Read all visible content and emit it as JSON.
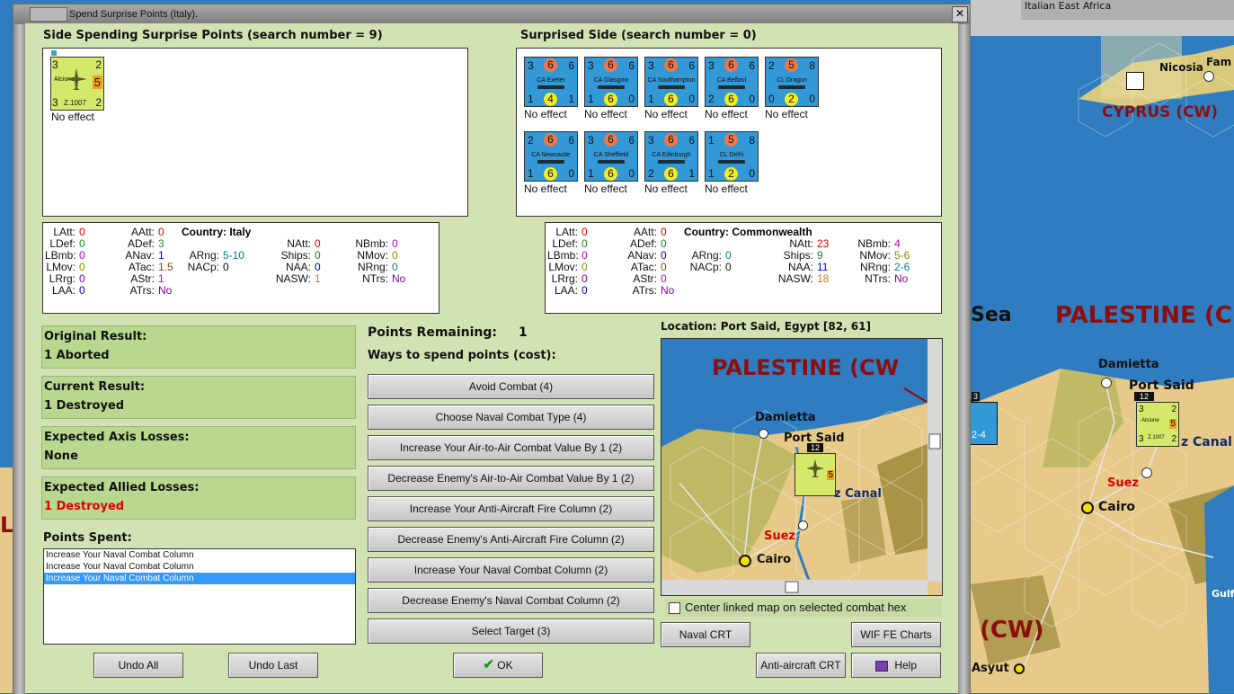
{
  "background_map": {
    "labels": {
      "italian_east_africa": "Italian East Africa",
      "nicosia": "Nicosia",
      "fam": "Fam",
      "cyprus": "CYPRUS (CW)",
      "sea": "Sea",
      "palestine": "PALESTINE (C",
      "damietta": "Damietta",
      "port_said": "Port Said",
      "canal": "z Canal",
      "suez": "Suez",
      "cairo": "Cairo",
      "cw": "(CW)",
      "asyut": "Asyut",
      "gulf": "Gulf",
      "l": "L",
      "t": "T"
    },
    "unit_stack": {
      "count": "12",
      "left": "3",
      "right": "2",
      "bottom_left": "3",
      "bottom_right": "2",
      "name": "Alcione",
      "type": "Z.1007",
      "value": "5"
    },
    "partial_unit": {
      "top": "3",
      "bottom": "2-4"
    }
  },
  "dialog": {
    "title": "Spend Surprise Points (Italy).",
    "close_label": "✕"
  },
  "side_spending": {
    "header": "Side Spending Surprise Points (search number = 9)",
    "units": [
      {
        "name": "Alcione",
        "type": "Z.1007",
        "tl": "3",
        "tr": "2",
        "bl": "3",
        "br": "2",
        "val": "5",
        "effect": "No effect"
      }
    ]
  },
  "surprised_side": {
    "header": "Surprised Side (search number = 0)",
    "units": [
      {
        "name": "CA Exeter",
        "tl": "3",
        "tc": "6",
        "tr": "6",
        "bl": "1",
        "bc": "4",
        "br": "1",
        "effect": "No effect"
      },
      {
        "name": "CA Glasgow",
        "tl": "3",
        "tc": "6",
        "tr": "6",
        "bl": "1",
        "bc": "6",
        "br": "0",
        "effect": "No effect"
      },
      {
        "name": "CA Southampton",
        "tl": "3",
        "tc": "6",
        "tr": "6",
        "bl": "1",
        "bc": "6",
        "br": "0",
        "effect": "No effect"
      },
      {
        "name": "CA Belfast",
        "tl": "3",
        "tc": "6",
        "tr": "6",
        "bl": "2",
        "bc": "6",
        "br": "0",
        "effect": "No effect"
      },
      {
        "name": "CL Dragon",
        "tl": "2",
        "tc": "5",
        "tr": "8",
        "bl": "0",
        "bc": "2",
        "br": "0",
        "effect": "No effect"
      },
      {
        "name": "CA Newcastle",
        "tl": "2",
        "tc": "6",
        "tr": "6",
        "bl": "1",
        "bc": "6",
        "br": "0",
        "effect": "No effect"
      },
      {
        "name": "CA Sheffield",
        "tl": "3",
        "tc": "6",
        "tr": "6",
        "bl": "1",
        "bc": "6",
        "br": "0",
        "effect": "No effect"
      },
      {
        "name": "CA Edinburgh",
        "tl": "3",
        "tc": "6",
        "tr": "6",
        "bl": "2",
        "bc": "6",
        "br": "1",
        "effect": "No effect"
      },
      {
        "name": "CL Delhi",
        "tl": "1",
        "tc": "5",
        "tr": "8",
        "bl": "1",
        "bc": "2",
        "br": "0",
        "effect": "No effect"
      }
    ]
  },
  "stats_italy": {
    "country_label": "Country: Italy",
    "latt": {
      "label": "LAtt:",
      "value": "0"
    },
    "ldef": {
      "label": "LDef:",
      "value": "0"
    },
    "lbmb": {
      "label": "LBmb:",
      "value": "0"
    },
    "lmov": {
      "label": "LMov:",
      "value": "0"
    },
    "lrrg": {
      "label": "LRrg:",
      "value": "0"
    },
    "laa": {
      "label": "LAA:",
      "value": "0"
    },
    "aatt": {
      "label": "AAtt:",
      "value": "0"
    },
    "adef": {
      "label": "ADef:",
      "value": "3"
    },
    "anav": {
      "label": "ANav:",
      "value": "1"
    },
    "atac": {
      "label": "ATac:",
      "value": "1.5"
    },
    "astr": {
      "label": "AStr:",
      "value": "1"
    },
    "atrs": {
      "label": "ATrs:",
      "value": "No"
    },
    "arng": {
      "label": "ARng:",
      "value": "5-10"
    },
    "nacp": {
      "label": "NACp:",
      "value": "0"
    },
    "natt": {
      "label": "NAtt:",
      "value": "0"
    },
    "ships": {
      "label": "Ships:",
      "value": "0"
    },
    "naa": {
      "label": "NAA:",
      "value": "0"
    },
    "nasw": {
      "label": "NASW:",
      "value": "1"
    },
    "nbmb": {
      "label": "NBmb:",
      "value": "0"
    },
    "nmov": {
      "label": "NMov:",
      "value": "0"
    },
    "nrng": {
      "label": "NRng:",
      "value": "0"
    },
    "ntrs": {
      "label": "NTrs:",
      "value": "No"
    }
  },
  "stats_cw": {
    "country_label": "Country: Commonwealth",
    "latt": {
      "label": "LAtt:",
      "value": "0"
    },
    "ldef": {
      "label": "LDef:",
      "value": "0"
    },
    "lbmb": {
      "label": "LBmb:",
      "value": "0"
    },
    "lmov": {
      "label": "LMov:",
      "value": "0"
    },
    "lrrg": {
      "label": "LRrg:",
      "value": "0"
    },
    "laa": {
      "label": "LAA:",
      "value": "0"
    },
    "aatt": {
      "label": "AAtt:",
      "value": "0"
    },
    "adef": {
      "label": "ADef:",
      "value": "0"
    },
    "anav": {
      "label": "ANav:",
      "value": "0"
    },
    "atac": {
      "label": "ATac:",
      "value": "0"
    },
    "astr": {
      "label": "AStr:",
      "value": "0"
    },
    "atrs": {
      "label": "ATrs:",
      "value": "No"
    },
    "arng": {
      "label": "ARng:",
      "value": "0"
    },
    "nacp": {
      "label": "NACp:",
      "value": "0"
    },
    "natt": {
      "label": "NAtt:",
      "value": "23"
    },
    "ships": {
      "label": "Ships:",
      "value": "9"
    },
    "naa": {
      "label": "NAA:",
      "value": "11"
    },
    "nasw": {
      "label": "NASW:",
      "value": "18"
    },
    "nbmb": {
      "label": "NBmb:",
      "value": "4"
    },
    "nmov": {
      "label": "NMov:",
      "value": "5-6"
    },
    "nrng": {
      "label": "NRng:",
      "value": "2-6"
    },
    "ntrs": {
      "label": "NTrs:",
      "value": "No"
    }
  },
  "results": {
    "original": {
      "label": "Original Result:",
      "value": "1 Aborted"
    },
    "current": {
      "label": "Current Result:",
      "value": "1 Destroyed"
    },
    "axis_losses": {
      "label": "Expected Axis Losses:",
      "value": "None"
    },
    "allied_losses": {
      "label": "Expected Allied Losses:",
      "value": "1 Destroyed"
    }
  },
  "points_spent": {
    "label": "Points Spent:",
    "items": [
      "Increase Your Naval Combat Column",
      "Increase Your Naval Combat Column",
      "Increase Your Naval Combat Column"
    ]
  },
  "points": {
    "remaining_label": "Points Remaining:",
    "remaining_value": "1",
    "ways_label": "Ways to spend points (cost):"
  },
  "options": [
    "Avoid Combat (4)",
    "Choose Naval Combat Type (4)",
    "Increase Your Air-to-Air Combat Value By 1 (2)",
    "Decrease Enemy's Air-to-Air Combat Value By 1 (2)",
    "Increase Your Anti-Aircraft Fire Column (2)",
    "Decrease Enemy's Anti-Aircraft Fire Column (2)",
    "Increase Your Naval Combat Column (2)",
    "Decrease Enemy's Naval Combat Column (2)",
    "Select Target (3)"
  ],
  "location": {
    "label": "Location: Port Said, Egypt [82, 61]",
    "minimap": {
      "palestine": "PALESTINE (CW",
      "damietta": "Damietta",
      "port_said": "Port Said",
      "canal": "z Canal",
      "suez": "Suez",
      "cairo": "Cairo",
      "stack_count": "12"
    },
    "center_checkbox_label": "Center linked map on selected combat hex"
  },
  "buttons": {
    "undo_all": "Undo All",
    "undo_last": "Undo Last",
    "ok": "OK",
    "naval_crt": "Naval CRT",
    "wif_fe_charts": "WIF FE Charts",
    "anti_aircraft_crt": "Anti-aircraft CRT",
    "help": "Help"
  },
  "colors": {
    "dialog_bg": "#d3e2b3",
    "result_box": "#b8d890",
    "ship_counter": "#3398d6",
    "air_counter": "#d6e86a",
    "sea": "#2f7dc0",
    "desert": "#e7c98a"
  }
}
